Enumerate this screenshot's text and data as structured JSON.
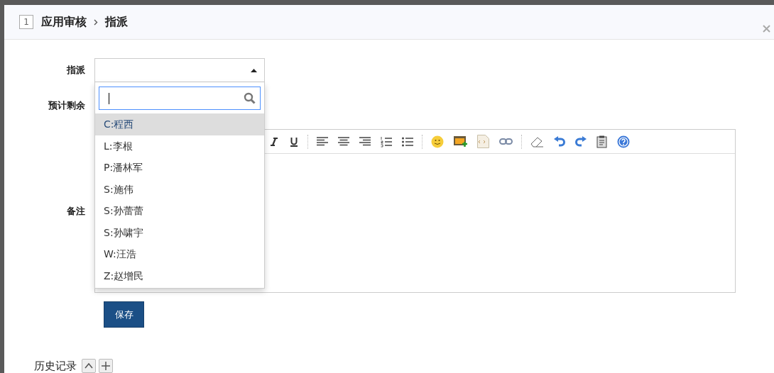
{
  "dialog": {
    "step": "1",
    "breadcrumb": [
      "应用审核",
      "指派"
    ]
  },
  "form": {
    "assign_label": "指派",
    "assign_dropdown": {
      "expanded": true,
      "options": [
        {
          "label": "C:程西",
          "selected": true
        },
        {
          "label": "L:李根",
          "selected": false
        },
        {
          "label": "P:潘林军",
          "selected": false
        },
        {
          "label": "S:施伟",
          "selected": false
        },
        {
          "label": "S:孙蕾蕾",
          "selected": false
        },
        {
          "label": "S:孙啸宇",
          "selected": false
        },
        {
          "label": "W:汪浩",
          "selected": false
        },
        {
          "label": "Z:赵增民",
          "selected": false
        }
      ]
    },
    "remaining_label": "预计剩余",
    "note_label": "备注",
    "save_button": "保存"
  },
  "history": {
    "label": "历史记录"
  }
}
